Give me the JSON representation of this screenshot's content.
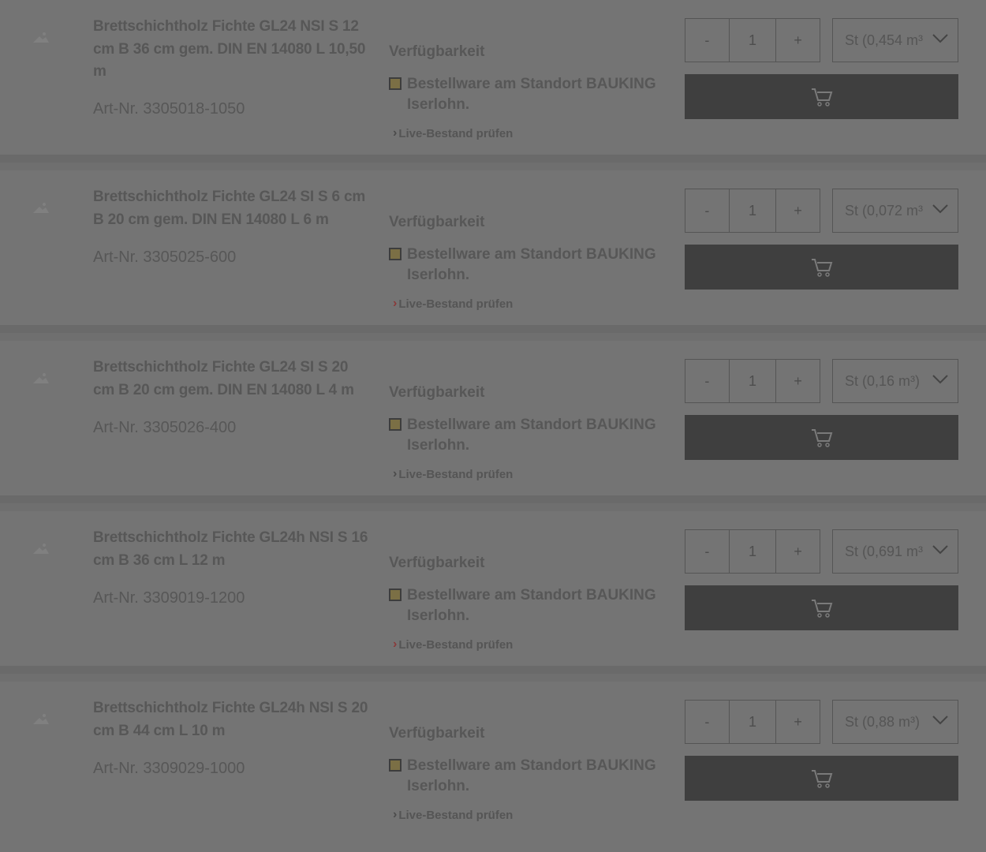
{
  "availability_label": "Verfügbarkeit",
  "live_check_label": "Live-Bestand prüfen",
  "qty_minus": "-",
  "qty_plus": "+",
  "colors": {
    "cart_button": "#3f3f3f",
    "availability_marker": "#7b6f45"
  },
  "products": [
    {
      "title": "Brettschichtholz Fichte GL24 NSI S 12 cm B 36 cm gem. DIN EN 14080 L 10,50 m",
      "art_nr": "Art-Nr.  3305018-1050",
      "availability": "Bestellware am Standort BAUKING Iserlohn.",
      "qty": "1",
      "unit": "St (0,454 m³"
    },
    {
      "title": "Brettschichtholz Fichte GL24 SI S 6 cm B 20 cm gem. DIN EN 14080 L 6 m",
      "art_nr": "Art-Nr.  3305025-600",
      "availability": "Bestellware am Standort BAUKING Iserlohn.",
      "qty": "1",
      "unit": "St (0,072 m³"
    },
    {
      "title": "Brettschichtholz Fichte GL24 SI S 20 cm B 20 cm gem. DIN EN 14080 L 4 m",
      "art_nr": "Art-Nr.  3305026-400",
      "availability": "Bestellware am Standort BAUKING Iserlohn.",
      "qty": "1",
      "unit": "St (0,16 m³)"
    },
    {
      "title": "Brettschichtholz Fichte GL24h NSI S 16 cm B 36 cm L 12 m",
      "art_nr": "Art-Nr.  3309019-1200",
      "availability": "Bestellware am Standort BAUKING Iserlohn.",
      "qty": "1",
      "unit": "St (0,691 m³"
    },
    {
      "title": "Brettschichtholz Fichte GL24h NSI S 20 cm B 44 cm L 10 m",
      "art_nr": "Art-Nr.  3309029-1000",
      "availability": "Bestellware am Standort BAUKING Iserlohn.",
      "qty": "1",
      "unit": "St (0,88 m³)"
    }
  ]
}
